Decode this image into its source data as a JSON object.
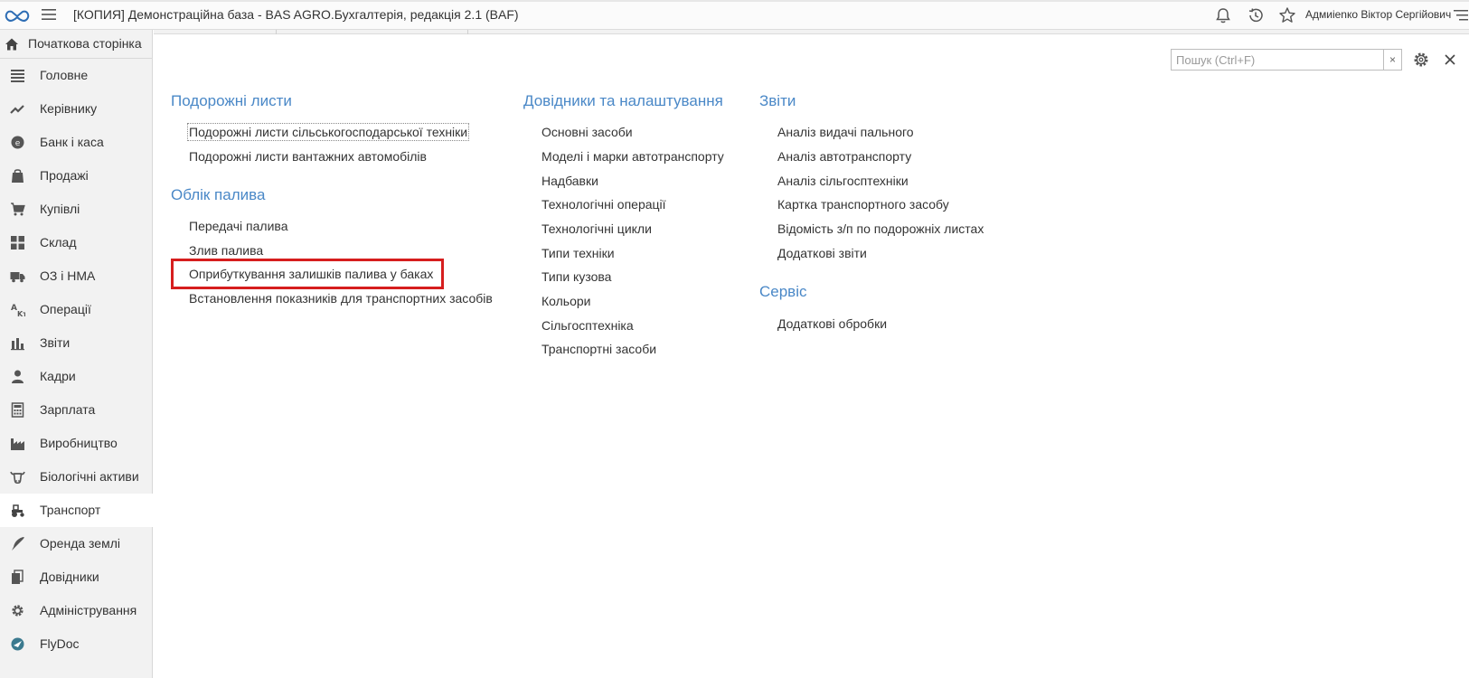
{
  "window": {
    "title": "[КОПИЯ] Демонстраційна база - BAS AGRO.Бухгалтерія, редакція 2.1  (BAF)",
    "user_name": "Адмиienко Віктор Сергійович"
  },
  "toolbar": {
    "icons": [
      "bell-icon",
      "history-icon",
      "star-icon",
      "settings-menu-icon"
    ]
  },
  "sidebar": {
    "home_label": "Початкова сторінка",
    "items": [
      {
        "label": "Головне",
        "icon": "list-icon"
      },
      {
        "label": "Керівнику",
        "icon": "trend-icon"
      },
      {
        "label": "Банк і каса",
        "icon": "coins-icon"
      },
      {
        "label": "Продажі",
        "icon": "bag-icon"
      },
      {
        "label": "Купівлі",
        "icon": "cart-icon"
      },
      {
        "label": "Склад",
        "icon": "grid-icon"
      },
      {
        "label": "ОЗ і НМА",
        "icon": "truck-icon"
      },
      {
        "label": "Операції",
        "icon": "operations-icon"
      },
      {
        "label": "Звіти",
        "icon": "bar-chart-icon"
      },
      {
        "label": "Кадри",
        "icon": "person-icon"
      },
      {
        "label": "Зарплата",
        "icon": "calculator-icon"
      },
      {
        "label": "Виробництво",
        "icon": "factory-icon"
      },
      {
        "label": "Біологічні активи",
        "icon": "cow-icon"
      },
      {
        "label": "Транспорт",
        "icon": "tractor-icon"
      },
      {
        "label": "Оренда землі",
        "icon": "feather-icon"
      },
      {
        "label": "Довідники",
        "icon": "books-icon"
      },
      {
        "label": "Адміністрування",
        "icon": "gear-icon"
      },
      {
        "label": "FlyDoc",
        "icon": "flydoc-icon"
      }
    ],
    "active_item": "Транспорт"
  },
  "search": {
    "placeholder": "Пошук (Ctrl+F)",
    "value": "",
    "clear_label": "×"
  },
  "main": {
    "groups": [
      {
        "title": "Подорожні листи",
        "links": [
          "Подорожні листи сільськогосподарської техніки",
          "Подорожні листи вантажних автомобілів"
        ]
      },
      {
        "title": "Облік палива",
        "links": [
          "Передачі палива",
          "Злив палива",
          "Оприбуткування залишків палива у баках",
          "Встановлення показників для транспортних засобів"
        ]
      },
      {
        "title": "Довідники та налаштування",
        "links": [
          "Основні засоби",
          "Моделі і марки автотранспорту",
          "Надбавки",
          "Технологічні операції",
          "Технологічні цикли",
          "Типи техніки",
          "Типи кузова",
          "Кольори",
          "Сільгосптехніка",
          "Транспортні засоби"
        ]
      },
      {
        "title": "Звіти",
        "links": [
          "Аналіз видачі пального",
          "Аналіз автотранспорту",
          "Аналіз сільгосптехніки",
          "Картка транспортного засобу",
          "Відомість з/п по подорожніх листах",
          "Додаткові звіти"
        ]
      },
      {
        "title": "Сервіс",
        "links": [
          "Додаткові обробки"
        ]
      }
    ],
    "highlighted_link": "Оприбуткування залишків палива у баках",
    "colors": {
      "group_title": "#4a88c7",
      "highlight": "#d61e1e"
    }
  }
}
